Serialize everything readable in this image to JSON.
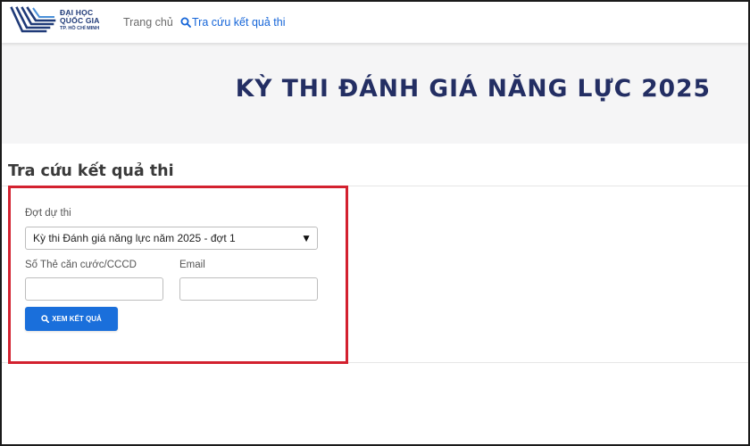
{
  "header": {
    "logo": {
      "line1": "ĐẠI HỌC",
      "line2": "QUỐC GIA",
      "line3": "TP. HỒ CHÍ MINH"
    },
    "nav": {
      "home": "Trang chủ",
      "lookup": "Tra cứu kết quả thi"
    }
  },
  "banner": {
    "title": "KỲ THI ĐÁNH GIÁ NĂNG LỰC 2025"
  },
  "section": {
    "title": "Tra cứu kết quả thi"
  },
  "form": {
    "round_label": "Đợt dự thi",
    "round_selected": "Kỳ thi Đánh giá năng lực năm 2025 - đợt 1",
    "id_label": "Số Thẻ căn cước/CCCD",
    "id_value": "",
    "email_label": "Email",
    "email_value": "",
    "submit_label": "XEM KẾT QUẢ"
  },
  "colors": {
    "brand_navy": "#232e63",
    "link_blue": "#1565d8",
    "button_blue": "#1a6fdb",
    "highlight_red": "#d3212f"
  },
  "icons": [
    "university-logo-icon",
    "search-icon",
    "chevron-down-icon"
  ]
}
